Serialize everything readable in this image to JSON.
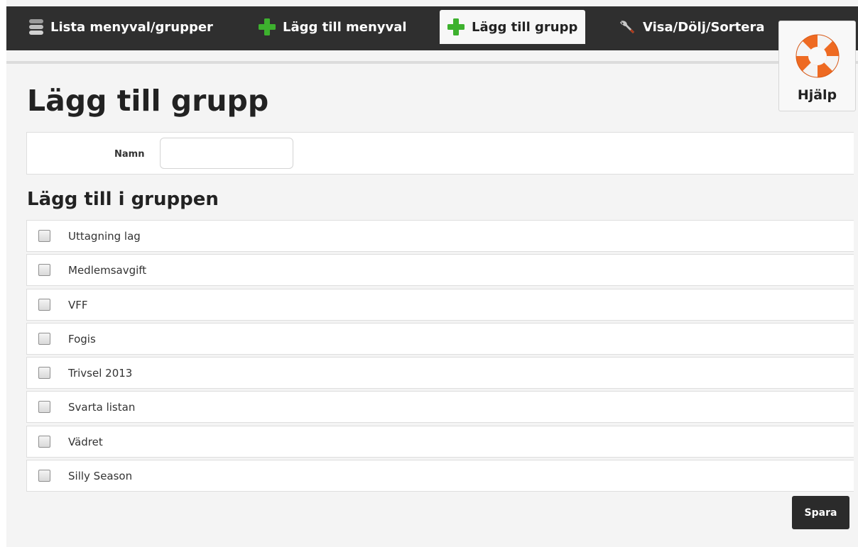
{
  "nav": {
    "tabs": [
      {
        "label": "Lista menyval/grupper",
        "icon": "database-icon",
        "active": false
      },
      {
        "label": "Lägg till menyval",
        "icon": "plus-icon",
        "active": false
      },
      {
        "label": "Lägg till grupp",
        "icon": "plus-icon",
        "active": true
      },
      {
        "label": "Visa/Dölj/Sortera",
        "icon": "wrench-icon",
        "active": false
      }
    ]
  },
  "help": {
    "label": "Hjälp",
    "icon": "lifebuoy-icon"
  },
  "page": {
    "title": "Lägg till grupp"
  },
  "form": {
    "name_label": "Namn",
    "name_value": "",
    "section_title": "Lägg till i gruppen",
    "items": [
      {
        "label": "Uttagning lag",
        "checked": false
      },
      {
        "label": "Medlemsavgift",
        "checked": false
      },
      {
        "label": "VFF",
        "checked": false
      },
      {
        "label": "Fogis",
        "checked": false
      },
      {
        "label": "Trivsel 2013",
        "checked": false
      },
      {
        "label": "Svarta listan",
        "checked": false
      },
      {
        "label": "Vädret",
        "checked": false
      },
      {
        "label": "Silly Season",
        "checked": false
      }
    ],
    "save_label": "Spara"
  },
  "colors": {
    "topbar": "#2f2f2f",
    "plus_green": "#3db12e",
    "buoy_orange": "#ee6a22"
  }
}
